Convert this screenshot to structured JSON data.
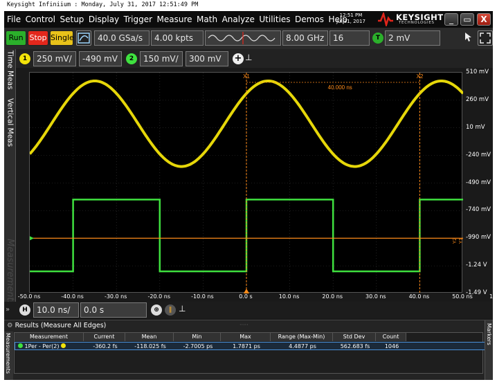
{
  "caption": "Keysight Infiniium : Monday, July 31, 2017 12:51:49 PM",
  "menu": [
    "File",
    "Control",
    "Setup",
    "Display",
    "Trigger",
    "Measure",
    "Math",
    "Analyze",
    "Utilities",
    "Demos",
    "Help"
  ],
  "clock": {
    "time": "12:51 PM",
    "date": "Jul 31, 2017"
  },
  "brand": {
    "name": "KEYSIGHT",
    "sub": "TECHNOLOGIES"
  },
  "window_controls": {
    "min": "_",
    "restore": "▭",
    "close": "X"
  },
  "toolbar": {
    "run": "Run",
    "stop": "Stop",
    "single": "Single",
    "sample_rate": "40.0 GSa/s",
    "memory_depth": "4.00 kpts",
    "bandwidth": "8.00 GHz",
    "averaging": "16",
    "trigger_badge": "T",
    "trigger_level": "2 mV"
  },
  "channels": {
    "ch1": {
      "badge": "1",
      "scale": "250 mV/",
      "offset": "-490 mV",
      "color": "#f2e30a"
    },
    "ch2": {
      "badge": "2",
      "scale": "150 mV/",
      "offset": "300 mV",
      "color": "#3fe13f"
    }
  },
  "side_tabs": {
    "time": "Time Meas",
    "vertical": "Vertical Meas",
    "watermark": "Measurements"
  },
  "vertical_labels": [
    "510 mV",
    "260 mV",
    "10 mV",
    "-240 mV",
    "-490 mV",
    "-740 mV",
    "-990 mV",
    "-1.24 V",
    "-1.49 V"
  ],
  "time_labels": [
    "-50.0 ns",
    "-40.0 ns",
    "-30.0 ns",
    "-20.0 ns",
    "-10.0 ns",
    "0.0 s",
    "10.0 ns",
    "20.0 ns",
    "30.0 ns",
    "40.0 ns",
    "50.0 ns"
  ],
  "markers": {
    "x1": "X1",
    "x2": "X2",
    "delta": "40.000 ns",
    "y_marker": "Y2",
    "y_marker_alt": "Y1"
  },
  "horizontal": {
    "badge": "H",
    "time_scale": "10.0 ns/",
    "position": "0.0 s"
  },
  "results": {
    "title": "Results   (Measure All Edges)",
    "headers": [
      "Measurement",
      "Current",
      "Mean",
      "Min",
      "Max",
      "Range (Max-Min)",
      "Std Dev",
      "Count"
    ],
    "rows": [
      {
        "name": "1Per - Per(2)",
        "current": "-360.2 fs",
        "mean": "-118.025 fs",
        "min": "-2.7005 ps",
        "max": "1.7871 ps",
        "range": "4.4877 ps",
        "std_dev": "562.683 fs",
        "count": "1046"
      }
    ],
    "right_tab": "Markers",
    "left_tab": "Measurements"
  },
  "colors": {
    "ch1": "#f2e30a",
    "ch2": "#3fe13f",
    "marker": "#ff8c1a",
    "grid": "#3a3a3a"
  }
}
